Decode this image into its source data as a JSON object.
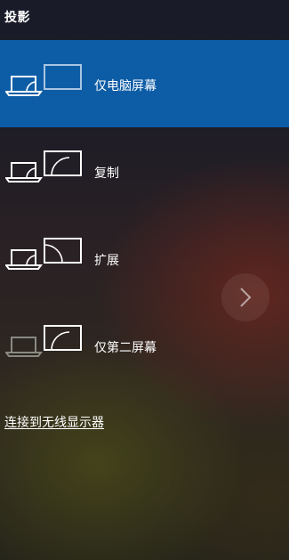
{
  "panel": {
    "title": "投影"
  },
  "options": [
    {
      "label": "仅电脑屏幕",
      "icon": "pc-screen-only-icon",
      "selected": true
    },
    {
      "label": "复制",
      "icon": "duplicate-icon",
      "selected": false
    },
    {
      "label": "扩展",
      "icon": "extend-icon",
      "selected": false
    },
    {
      "label": "仅第二屏幕",
      "icon": "second-screen-only-icon",
      "selected": false
    }
  ],
  "connect_link": "连接到无线显示器",
  "next_button": {
    "icon": "chevron-right-icon"
  },
  "colors": {
    "selected_background": "#0d5da6",
    "text": "#ffffff",
    "dim_icon": "#8a8a80",
    "muted_icon": "#a9c5e2"
  }
}
